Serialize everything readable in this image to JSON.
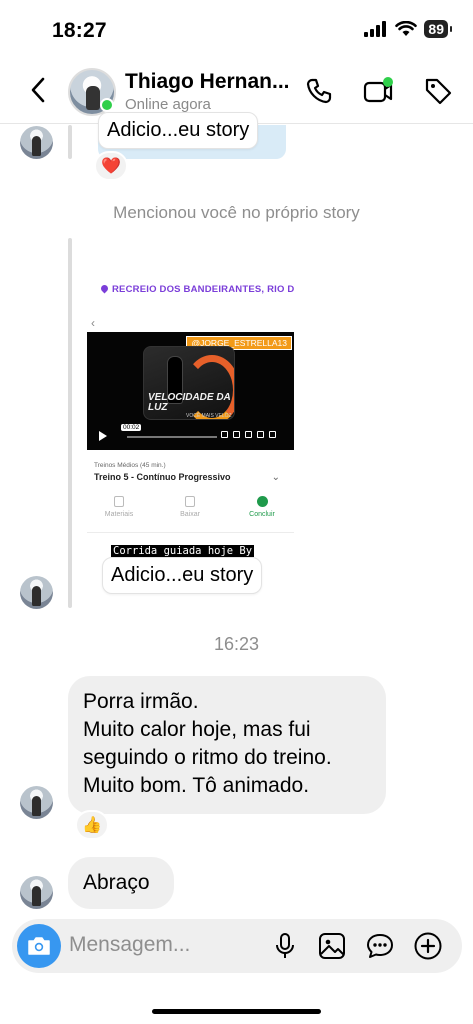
{
  "status_bar": {
    "time": "18:27",
    "battery": "89"
  },
  "header": {
    "contact_name": "Thiago Hernan...",
    "contact_status": "Online agora"
  },
  "messages": {
    "story_chip_top": "Adicio...eu story",
    "reaction_top": "❤️",
    "mention_note": "Mencionou você no próprio story",
    "story": {
      "location": "RECREIO DOS BANDEIRANTES, RIO DE JANEI...",
      "handle": "@JORGE_ESTRELLA13",
      "video_title": "VELOCIDADE DA LUZ",
      "video_subtitle": "VOCÊ MAIS VELOZ",
      "video_time": "00:02",
      "course_sub": "Treinos Médios (45 min.)",
      "course_title": "Treino 5 - Contínuo Progressivo",
      "actions": [
        "Materiais",
        "Baixar",
        "Concluir"
      ],
      "caption": "Corrida guiada hoje By",
      "chip": "Adicio...eu story"
    },
    "time_separator": "16:23",
    "bubble_1": "Porra irmão.\nMuito calor hoje, mas fui\nseguindo o ritmo do treino.\nMuito bom. Tô animado.",
    "reaction_bubble_1": "👍",
    "bubble_2": "Abraço"
  },
  "composer": {
    "placeholder": "Mensagem..."
  },
  "colors": {
    "online": "#2fcf4a",
    "camera_button": "#3797f0",
    "bubble_bg": "#efefef",
    "location_text": "#7b3ed9",
    "handle_bg": "#f29a18"
  },
  "icons": [
    "back-icon",
    "phone-icon",
    "video-call-icon",
    "tag-icon",
    "camera-icon",
    "mic-icon",
    "gallery-icon",
    "sticker-icon",
    "plus-icon"
  ]
}
